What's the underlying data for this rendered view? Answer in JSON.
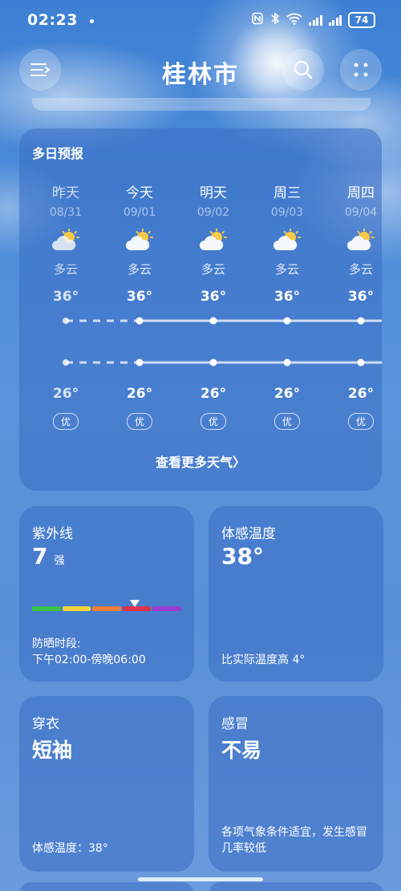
{
  "status_bar": {
    "time": "02:23",
    "battery": "74"
  },
  "header": {
    "city": "桂林市"
  },
  "forecast": {
    "title": "多日预报",
    "more_link": "查看更多天气〉",
    "days": [
      {
        "name": "昨天",
        "date": "08/31",
        "condition": "多云",
        "high": "36°",
        "low": "26°",
        "aqi": "优"
      },
      {
        "name": "今天",
        "date": "09/01",
        "condition": "多云",
        "high": "36°",
        "low": "26°",
        "aqi": "优"
      },
      {
        "name": "明天",
        "date": "09/02",
        "condition": "多云",
        "high": "36°",
        "low": "26°",
        "aqi": "优"
      },
      {
        "name": "周三",
        "date": "09/03",
        "condition": "多云",
        "high": "36°",
        "low": "26°",
        "aqi": "优"
      },
      {
        "name": "周四",
        "date": "09/04",
        "condition": "多云",
        "high": "36°",
        "low": "26°",
        "aqi": "优"
      }
    ],
    "icon": "partly-cloudy-icon"
  },
  "uv": {
    "label": "紫外线",
    "value": "7",
    "level": "强",
    "scale_colors": [
      "#3cc34a",
      "#f3d23a",
      "#f0803a",
      "#e0334a",
      "#9b3bd0"
    ],
    "position_fraction": 0.69,
    "footer_line1": "防晒时段:",
    "footer_line2": "下午02:00-傍晚06:00"
  },
  "feels_like": {
    "label": "体感温度",
    "value": "38°",
    "note": "比实际温度高 4°"
  },
  "clothing": {
    "label": "穿衣",
    "value": "短袖",
    "note": "体感温度：38°"
  },
  "cold": {
    "label": "感冒",
    "value": "不易",
    "note": "各项气象条件适宜，发生感冒几率较低"
  }
}
